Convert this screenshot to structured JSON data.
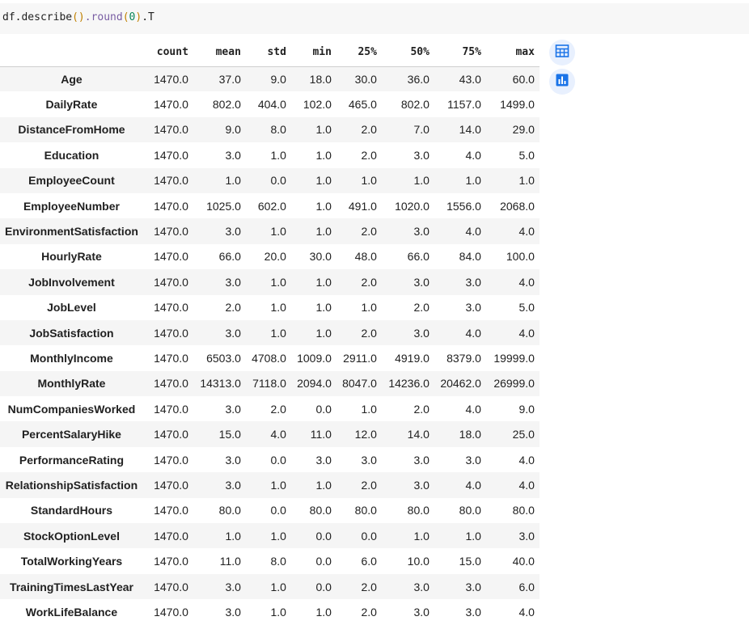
{
  "code_cell": {
    "code_parts": [
      "df.describe",
      "()",
      ".round",
      "(",
      "0",
      ")",
      ".T"
    ]
  },
  "table": {
    "columns": [
      "count",
      "mean",
      "std",
      "min",
      "25%",
      "50%",
      "75%",
      "max"
    ],
    "rows": [
      {
        "label": "Age",
        "values": [
          "1470.0",
          "37.0",
          "9.0",
          "18.0",
          "30.0",
          "36.0",
          "43.0",
          "60.0"
        ]
      },
      {
        "label": "DailyRate",
        "values": [
          "1470.0",
          "802.0",
          "404.0",
          "102.0",
          "465.0",
          "802.0",
          "1157.0",
          "1499.0"
        ]
      },
      {
        "label": "DistanceFromHome",
        "values": [
          "1470.0",
          "9.0",
          "8.0",
          "1.0",
          "2.0",
          "7.0",
          "14.0",
          "29.0"
        ]
      },
      {
        "label": "Education",
        "values": [
          "1470.0",
          "3.0",
          "1.0",
          "1.0",
          "2.0",
          "3.0",
          "4.0",
          "5.0"
        ]
      },
      {
        "label": "EmployeeCount",
        "values": [
          "1470.0",
          "1.0",
          "0.0",
          "1.0",
          "1.0",
          "1.0",
          "1.0",
          "1.0"
        ]
      },
      {
        "label": "EmployeeNumber",
        "values": [
          "1470.0",
          "1025.0",
          "602.0",
          "1.0",
          "491.0",
          "1020.0",
          "1556.0",
          "2068.0"
        ]
      },
      {
        "label": "EnvironmentSatisfaction",
        "values": [
          "1470.0",
          "3.0",
          "1.0",
          "1.0",
          "2.0",
          "3.0",
          "4.0",
          "4.0"
        ]
      },
      {
        "label": "HourlyRate",
        "values": [
          "1470.0",
          "66.0",
          "20.0",
          "30.0",
          "48.0",
          "66.0",
          "84.0",
          "100.0"
        ]
      },
      {
        "label": "JobInvolvement",
        "values": [
          "1470.0",
          "3.0",
          "1.0",
          "1.0",
          "2.0",
          "3.0",
          "3.0",
          "4.0"
        ]
      },
      {
        "label": "JobLevel",
        "values": [
          "1470.0",
          "2.0",
          "1.0",
          "1.0",
          "1.0",
          "2.0",
          "3.0",
          "5.0"
        ]
      },
      {
        "label": "JobSatisfaction",
        "values": [
          "1470.0",
          "3.0",
          "1.0",
          "1.0",
          "2.0",
          "3.0",
          "4.0",
          "4.0"
        ]
      },
      {
        "label": "MonthlyIncome",
        "values": [
          "1470.0",
          "6503.0",
          "4708.0",
          "1009.0",
          "2911.0",
          "4919.0",
          "8379.0",
          "19999.0"
        ]
      },
      {
        "label": "MonthlyRate",
        "values": [
          "1470.0",
          "14313.0",
          "7118.0",
          "2094.0",
          "8047.0",
          "14236.0",
          "20462.0",
          "26999.0"
        ]
      },
      {
        "label": "NumCompaniesWorked",
        "values": [
          "1470.0",
          "3.0",
          "2.0",
          "0.0",
          "1.0",
          "2.0",
          "4.0",
          "9.0"
        ]
      },
      {
        "label": "PercentSalaryHike",
        "values": [
          "1470.0",
          "15.0",
          "4.0",
          "11.0",
          "12.0",
          "14.0",
          "18.0",
          "25.0"
        ]
      },
      {
        "label": "PerformanceRating",
        "values": [
          "1470.0",
          "3.0",
          "0.0",
          "3.0",
          "3.0",
          "3.0",
          "3.0",
          "4.0"
        ]
      },
      {
        "label": "RelationshipSatisfaction",
        "values": [
          "1470.0",
          "3.0",
          "1.0",
          "1.0",
          "2.0",
          "3.0",
          "4.0",
          "4.0"
        ]
      },
      {
        "label": "StandardHours",
        "values": [
          "1470.0",
          "80.0",
          "0.0",
          "80.0",
          "80.0",
          "80.0",
          "80.0",
          "80.0"
        ]
      },
      {
        "label": "StockOptionLevel",
        "values": [
          "1470.0",
          "1.0",
          "1.0",
          "0.0",
          "0.0",
          "1.0",
          "1.0",
          "3.0"
        ]
      },
      {
        "label": "TotalWorkingYears",
        "values": [
          "1470.0",
          "11.0",
          "8.0",
          "0.0",
          "6.0",
          "10.0",
          "15.0",
          "40.0"
        ]
      },
      {
        "label": "TrainingTimesLastYear",
        "values": [
          "1470.0",
          "3.0",
          "1.0",
          "0.0",
          "2.0",
          "3.0",
          "3.0",
          "6.0"
        ]
      },
      {
        "label": "WorkLifeBalance",
        "values": [
          "1470.0",
          "3.0",
          "1.0",
          "1.0",
          "2.0",
          "3.0",
          "3.0",
          "4.0"
        ]
      }
    ]
  },
  "side_buttons": [
    {
      "icon": "table-icon"
    },
    {
      "icon": "bar-chart-icon"
    }
  ],
  "colors": {
    "accent": "#1a73e8",
    "button_bg": "#e8f0fe",
    "stripe": "#f5f5f5",
    "code_bg": "#f7f7f7"
  }
}
